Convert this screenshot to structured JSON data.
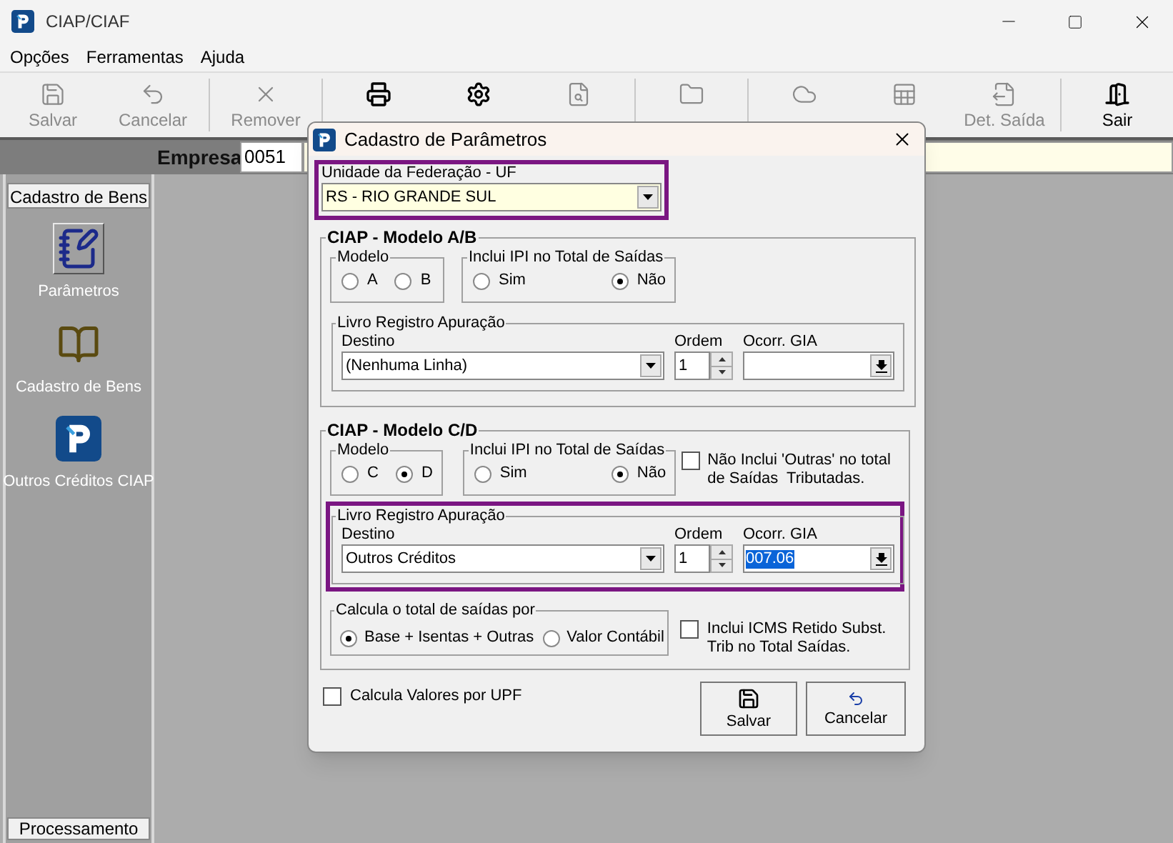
{
  "window": {
    "title": "CIAP/CIAF"
  },
  "menu": [
    {
      "label": "Opções"
    },
    {
      "label": "Ferramentas"
    },
    {
      "label": "Ajuda"
    }
  ],
  "toolbar": [
    {
      "label": "Salvar",
      "kind": "save",
      "disabled": true,
      "group_end": false
    },
    {
      "label": "Cancelar",
      "kind": "undo",
      "disabled": true,
      "group_end": true
    },
    {
      "label": "Remover",
      "kind": "remove",
      "disabled": true,
      "group_end": true
    },
    {
      "kind": "print",
      "disabled": false,
      "group_end": false
    },
    {
      "kind": "setup",
      "disabled": false,
      "group_end": false
    },
    {
      "kind": "find",
      "disabled": true,
      "group_end": true
    },
    {
      "kind": "calc",
      "disabled": true,
      "group_end": true
    },
    {
      "kind": "base",
      "disabled": true,
      "group_end": false
    },
    {
      "kind": "sheet",
      "disabled": true,
      "group_end": false
    },
    {
      "label": "Det. Saída",
      "kind": "out",
      "disabled": true,
      "group_end": true
    },
    {
      "label": "Sair",
      "kind": "exit",
      "disabled": false,
      "group_end": false
    }
  ],
  "empresa": {
    "label": "Empresa",
    "value": "0051"
  },
  "sidebar": {
    "header": "Cadastro de Bens",
    "items": [
      {
        "label": "Parâmetros",
        "kind": "notepad",
        "selected": true
      },
      {
        "label": "Cadastro de Bens",
        "kind": "book",
        "selected": false
      },
      {
        "label": "Outros Créditos CIAP",
        "kind": "logo",
        "selected": false
      }
    ],
    "footer": "Processamento"
  },
  "dialog": {
    "title": "Cadastro de Parâmetros",
    "uf": {
      "label": "Unidade da Federação - UF",
      "value": "RS - RIO GRANDE SUL",
      "highlighted": true
    },
    "ab": {
      "title": "CIAP - Modelo A/B",
      "modelo": {
        "label": "Modelo",
        "options": [
          {
            "label": "A",
            "selected": false
          },
          {
            "label": "B",
            "selected": false
          }
        ]
      },
      "ipi": {
        "label": "Inclui IPI no Total de Saídas",
        "options": [
          {
            "label": "Sim",
            "selected": false
          },
          {
            "label": "Não",
            "selected": true
          }
        ]
      },
      "livro": {
        "label": "Livro Registro Apuração",
        "highlighted": false,
        "destino_label": "Destino",
        "destino": "(Nenhuma Linha)",
        "ordem_label": "Ordem",
        "ordem": "1",
        "gia_label": "Ocorr. GIA"
      }
    },
    "cd": {
      "title": "CIAP - Modelo C/D",
      "modelo": {
        "label": "Modelo",
        "options": [
          {
            "label": "C",
            "selected": false
          },
          {
            "label": "D",
            "selected": true
          }
        ]
      },
      "ipi": {
        "label": "Inclui IPI no Total de Saídas",
        "options": [
          {
            "label": "Sim",
            "selected": false
          },
          {
            "label": "Não",
            "selected": true
          }
        ]
      },
      "outras": {
        "label": "Não Inclui 'Outras' no total de Saídas  Tributadas.",
        "checked": false
      },
      "livro": {
        "label": "Livro Registro Apuração",
        "highlighted": true,
        "destino_label": "Destino",
        "destino": "Outros Créditos",
        "ordem_label": "Ordem",
        "ordem": "1",
        "gia_label": "Ocorr. GIA",
        "gia": "007.06",
        "gia_selected": true
      },
      "calcula": {
        "label": "Calcula o total de saídas por",
        "options": [
          {
            "label": "Base + Isentas + Outras",
            "selected": true
          },
          {
            "label": "Valor Contábil",
            "selected": false
          }
        ]
      },
      "icms": {
        "label": "Inclui ICMS Retido Subst. Trib no Total Saídas.",
        "checked": false
      }
    },
    "upf": {
      "label": "Calcula Valores por UPF",
      "checked": false
    },
    "buttons": [
      {
        "label": "Salvar",
        "kind": "save"
      },
      {
        "label": "Cancelar",
        "kind": "undo"
      }
    ]
  }
}
